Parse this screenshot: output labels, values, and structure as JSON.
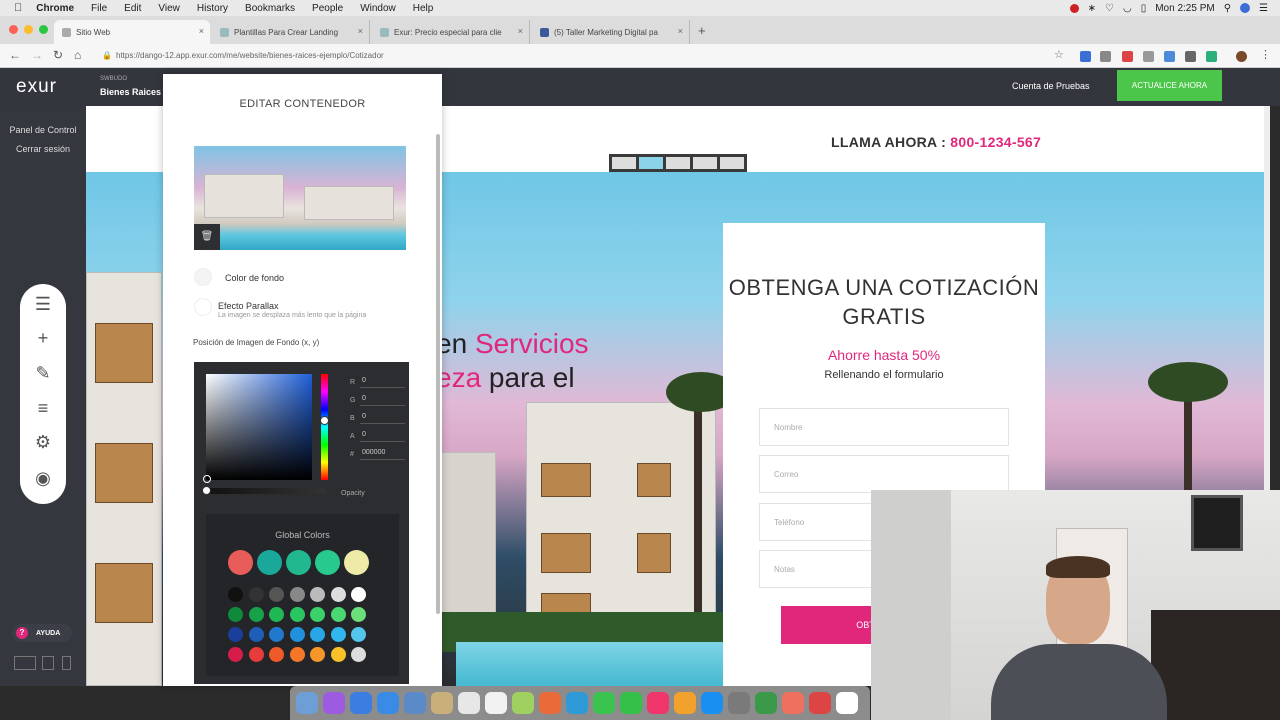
{
  "menubar": {
    "app": "Chrome",
    "items": [
      "File",
      "Edit",
      "View",
      "History",
      "Bookmarks",
      "People",
      "Window",
      "Help"
    ],
    "clock": "Mon 2:25 PM"
  },
  "browser": {
    "tabs": [
      {
        "title": "Sitio Web"
      },
      {
        "title": "Plantillas Para Crear Landing"
      },
      {
        "title": "Exur: Precio especial para clie"
      },
      {
        "title": "(5) Taller Marketing Digital pa"
      }
    ],
    "url": "https://dango-12.app.exur.com/me/website/bienes-raices-ejemplo/Cotizador"
  },
  "app": {
    "logo": "exur",
    "site_mini": "SWBUDO",
    "site_name": "Bienes Raices",
    "trial_label": "Cuenta de Pruebas",
    "upgrade_label": "ACTUALICE AHORA"
  },
  "sidebar": {
    "links": [
      "Panel de Control",
      "Cerrar sesión"
    ],
    "help_label": "AYUDA",
    "tools": [
      "menu-icon",
      "plus-icon",
      "pencil-icon",
      "filter-icon",
      "gear-icon",
      "eye-icon"
    ]
  },
  "canvas": {
    "call_label": "LLAMA AHORA : ",
    "call_phone": "800-1234-567",
    "hero_line1_pre": "en ",
    "hero_line1_hl": "Servicios",
    "hero_line2_hl": "eza",
    "hero_line2_post": " para el",
    "form": {
      "title": "OBTENGA UNA COTIZACIÓN GRATIS",
      "save": "Ahorre hasta 50%",
      "subtitle": "Rellenando el formulario",
      "fields": [
        "Nombre",
        "Correo",
        "Teléfono",
        "Notas"
      ],
      "submit": "OBTENER CO"
    }
  },
  "edit_panel": {
    "title": "EDITAR CONTENEDOR",
    "bg_color_label": "Color de fondo",
    "parallax_label": "Efecto Parallax",
    "parallax_hint": "La imagen se desplaza más lento que la página",
    "position_label": "Posición de Imagen de Fondo (x, y)",
    "picker": {
      "r_label": "R",
      "r": "0",
      "g_label": "G",
      "g": "0",
      "b_label": "B",
      "b": "0",
      "a_label": "A",
      "a": "0",
      "hex_label": "#",
      "hex": "000000",
      "opacity_label": "Opacity",
      "global_label": "Global Colors",
      "big_swatches": [
        "#e85d5a",
        "#1aa89a",
        "#21b890",
        "#27c98c",
        "#eeeba8"
      ],
      "rows": [
        [
          "#111111",
          "#333333",
          "#555555",
          "#888888",
          "#bbbbbb",
          "#dddddd",
          "#ffffff"
        ],
        [
          "#0f8a3a",
          "#17a24a",
          "#20b855",
          "#2ac760",
          "#3ad06a",
          "#4bd870",
          "#6be07a"
        ],
        [
          "#1b3e9a",
          "#1d5fb6",
          "#2079cc",
          "#2290dc",
          "#28a6e6",
          "#30b8ee",
          "#54c6ee"
        ],
        [
          "#d61d4a",
          "#e83b3b",
          "#f05a2a",
          "#f5782a",
          "#f7962a",
          "#f8c12a",
          "#dddddd"
        ]
      ]
    }
  },
  "dock": {
    "colors": [
      "#6d9fd6",
      "#9c5be0",
      "#3b7de0",
      "#3a8be6",
      "#5a8ac8",
      "#c9b07a",
      "#e7e7e7",
      "#f2f2f2",
      "#a0d060",
      "#ea6b3a",
      "#2f9ad8",
      "#39c24d",
      "#35c04a",
      "#f0356b",
      "#f2a22c",
      "#1a8ff2",
      "#7a7a7a",
      "#3a9a4a",
      "#f07060",
      "#d44",
      "#ffffff"
    ]
  }
}
